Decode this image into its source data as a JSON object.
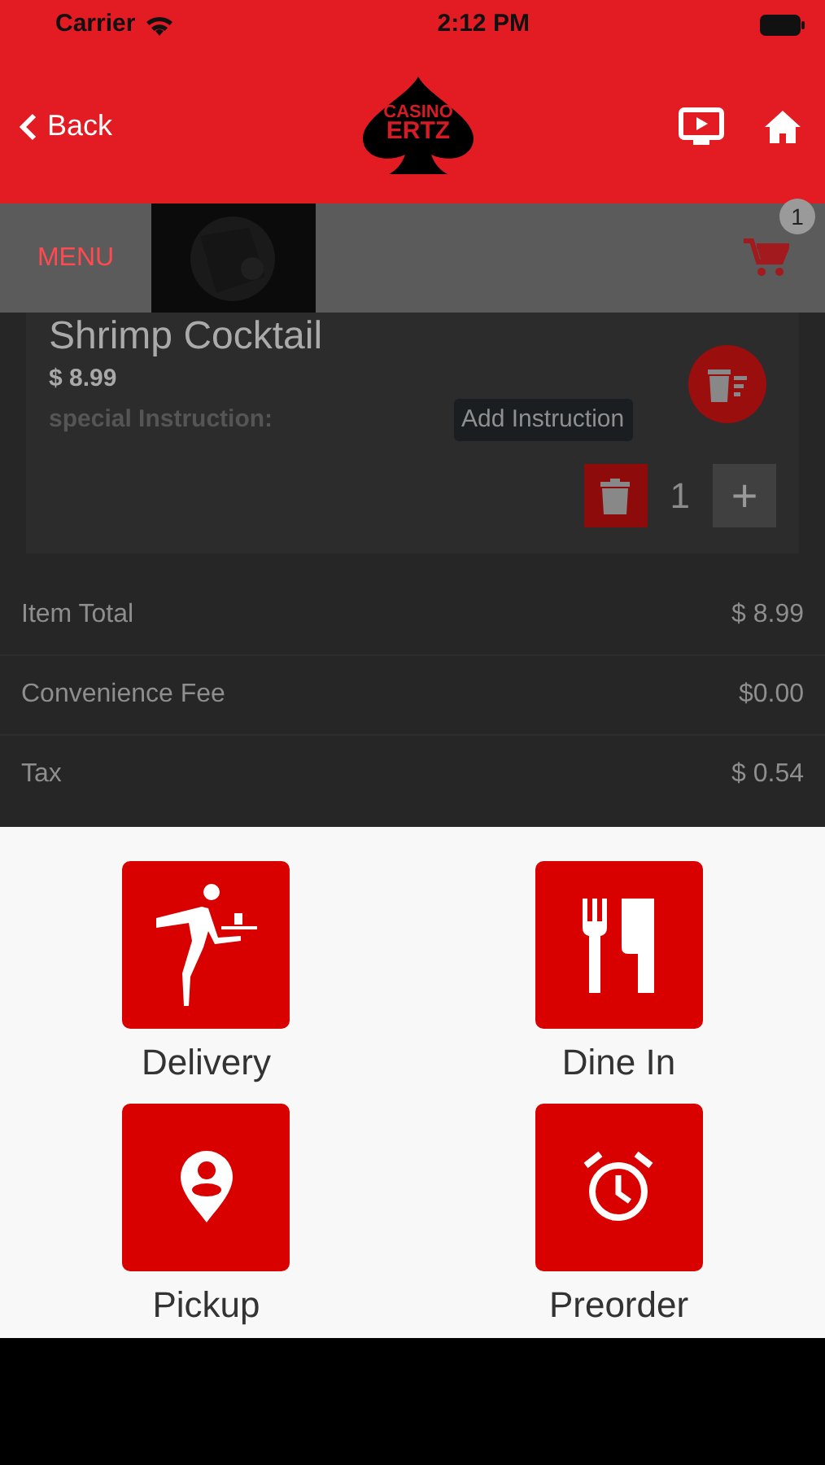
{
  "status_bar": {
    "carrier": "Carrier",
    "time": "2:12 PM"
  },
  "nav_bar": {
    "back_label": "Back",
    "logo_line_1": "CASINO",
    "logo_line_2": "ERTZ"
  },
  "menu_bar": {
    "label": "MENU",
    "cart_count": "1"
  },
  "cart_item": {
    "name": "Shrimp Cocktail",
    "price": "$ 8.99",
    "instruction_label": "special Instruction:",
    "add_instruction": "Add Instruction",
    "quantity": "1",
    "plus": "+"
  },
  "summary": [
    {
      "label": "Item Total",
      "value": "$ 8.99"
    },
    {
      "label": "Convenience Fee",
      "value": "$0.00"
    },
    {
      "label": "Tax",
      "value": "$ 0.54"
    }
  ],
  "order_types": [
    {
      "label": "Delivery",
      "kind": "delivery"
    },
    {
      "label": "Dine In",
      "kind": "dine_in"
    },
    {
      "label": "Pickup",
      "kind": "pickup"
    },
    {
      "label": "Preorder",
      "kind": "preorder"
    }
  ]
}
